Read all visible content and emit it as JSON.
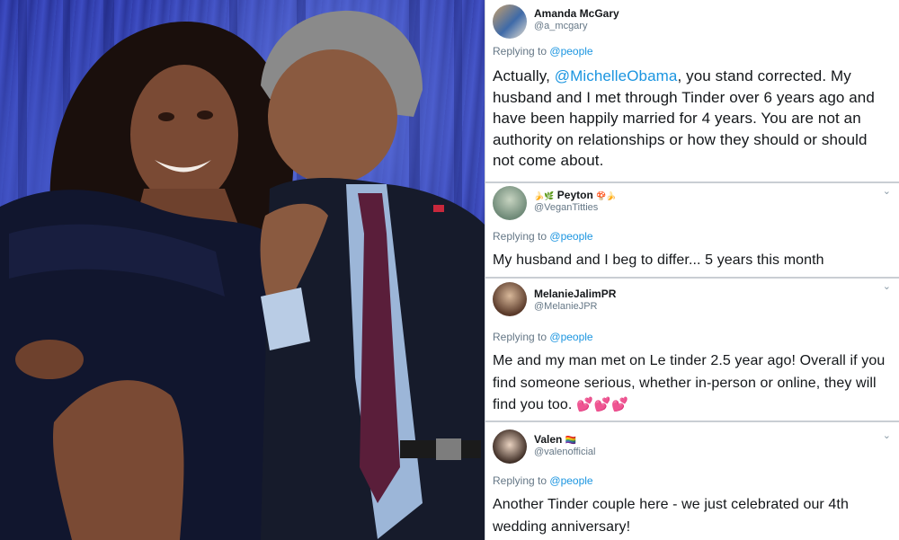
{
  "tweets": [
    {
      "display_name": "Amanda McGary",
      "handle": "@a_mcgary",
      "replying_prefix": "Replying to",
      "replying_to": "@people",
      "text_before": "Actually, ",
      "mention": "@MichelleObama",
      "text_after": ", you stand corrected. My husband and I met through Tinder over 6 years ago and have been happily married for 4 years. You are not an authority on relationships or how they should or should not come about."
    },
    {
      "display_name": "Peyton",
      "name_prefix_emoji": "🍌🌿",
      "name_suffix_emoji": "🍄🍌",
      "handle": "@VeganTitties",
      "replying_prefix": "Replying to",
      "replying_to": "@people",
      "text": "My husband and I beg to differ... 5 years this month"
    },
    {
      "display_name": "MelanieJalimPR",
      "handle": "@MelanieJPR",
      "replying_prefix": "Replying to",
      "replying_to": "@people",
      "text": "Me and my man met on Le tinder 2.5 year ago! Overall if you find someone serious, whether in-person or online, they will find you too.",
      "emoji": "💕💕💕"
    },
    {
      "display_name": "Valen",
      "name_suffix_emoji": "🏳️‍🌈",
      "handle": "@valenofficial",
      "replying_prefix": "Replying to",
      "replying_to": "@people",
      "text": "Another Tinder couple here - we just celebrated our 4th wedding anniversary!"
    }
  ],
  "icons": {
    "caret": "chevron-down-icon"
  },
  "colors": {
    "link": "#1b95e0",
    "text": "#14171a",
    "secondary": "#657786",
    "curtain": "#2a34a6"
  }
}
